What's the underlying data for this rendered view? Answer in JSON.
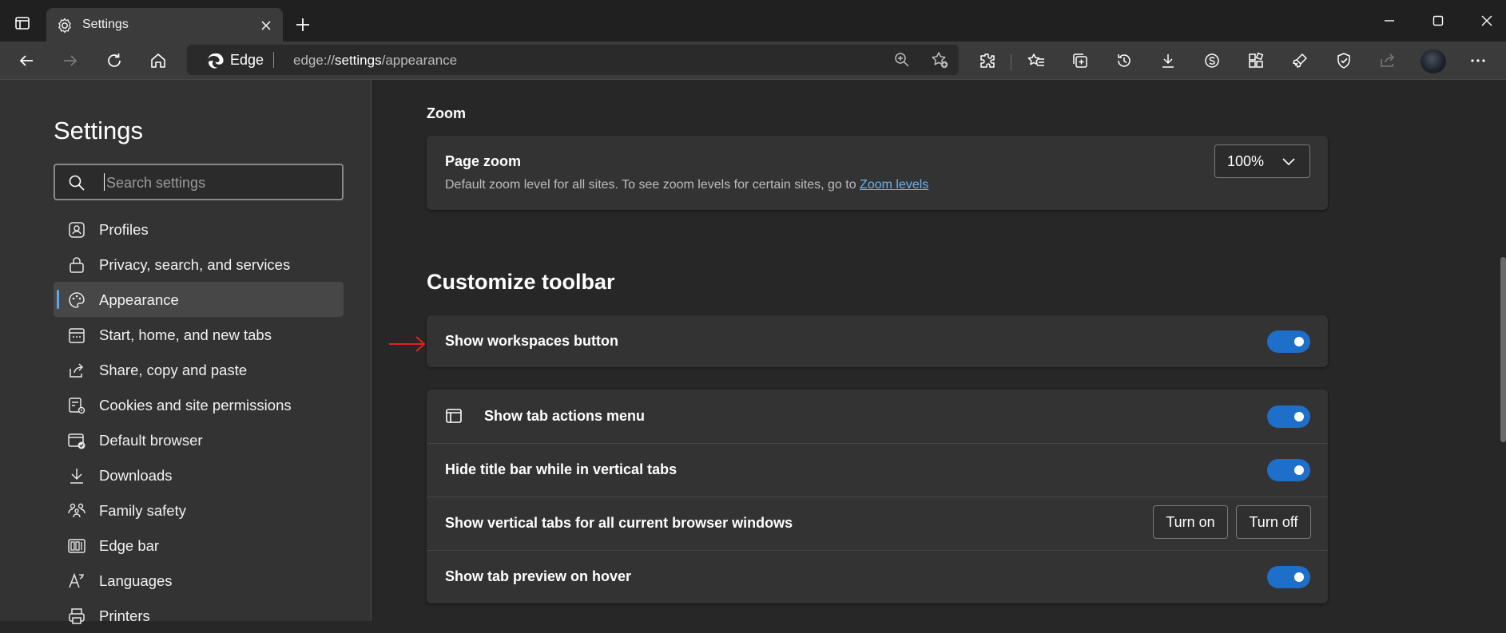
{
  "tab": {
    "title": "Settings"
  },
  "address": {
    "brand": "Edge",
    "url_scheme": "edge://",
    "url_host": "settings",
    "url_path": "/appearance"
  },
  "sidebar": {
    "title": "Settings",
    "search_placeholder": "Search settings",
    "items": [
      {
        "label": "Profiles",
        "icon": "profile-icon"
      },
      {
        "label": "Privacy, search, and services",
        "icon": "lock-icon"
      },
      {
        "label": "Appearance",
        "icon": "palette-icon",
        "active": true
      },
      {
        "label": "Start, home, and new tabs",
        "icon": "calendar-icon"
      },
      {
        "label": "Share, copy and paste",
        "icon": "share-icon"
      },
      {
        "label": "Cookies and site permissions",
        "icon": "cookie-gear-icon"
      },
      {
        "label": "Default browser",
        "icon": "default-browser-icon"
      },
      {
        "label": "Downloads",
        "icon": "download-icon"
      },
      {
        "label": "Family safety",
        "icon": "family-icon"
      },
      {
        "label": "Edge bar",
        "icon": "edge-bar-icon"
      },
      {
        "label": "Languages",
        "icon": "language-icon"
      },
      {
        "label": "Printers",
        "icon": "printer-icon"
      }
    ]
  },
  "zoom": {
    "section": "Zoom",
    "title": "Page zoom",
    "desc": "Default zoom level for all sites. To see zoom levels for certain sites, go to ",
    "link": "Zoom levels",
    "value": "100%"
  },
  "toolbar_section": {
    "title": "Customize toolbar",
    "workspaces": {
      "label": "Show workspaces button",
      "on": true
    },
    "rows": [
      {
        "label": "Show tab actions menu",
        "on": true
      },
      {
        "label": "Hide title bar while in vertical tabs",
        "on": true
      },
      {
        "label": "Show vertical tabs for all current browser windows",
        "btn_on": "Turn on",
        "btn_off": "Turn off"
      },
      {
        "label": "Show tab preview on hover",
        "on": true
      }
    ]
  },
  "colors": {
    "accent": "#1e6fc9",
    "link": "#6fb3f0",
    "annotation_arrow": "#e02020"
  }
}
